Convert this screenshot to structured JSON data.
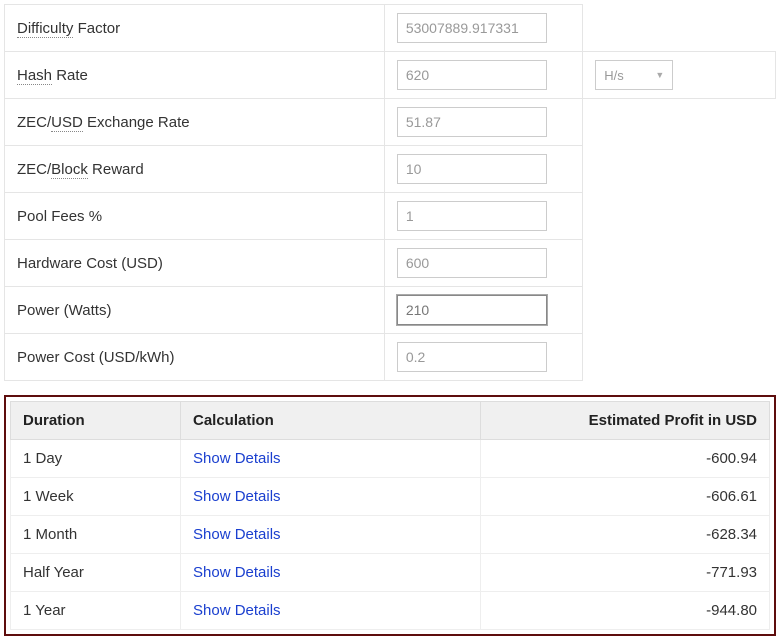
{
  "form": {
    "rows": [
      {
        "label_pre": "",
        "label_dotted": "Difficulty",
        "label_post": " Factor",
        "value": "53007889.917331",
        "has_select": false,
        "focused": false
      },
      {
        "label_pre": "",
        "label_dotted": "Hash",
        "label_post": " Rate",
        "value": "620",
        "has_select": true,
        "select_label": "H/s",
        "focused": false
      },
      {
        "label_pre": "ZEC/",
        "label_dotted": "USD",
        "label_post": " Exchange Rate",
        "value": "51.87",
        "has_select": false,
        "focused": false
      },
      {
        "label_pre": "ZEC/",
        "label_dotted": "Block",
        "label_post": " Reward",
        "value": "10",
        "has_select": false,
        "focused": false
      },
      {
        "label_pre": "Pool Fees %",
        "label_dotted": "",
        "label_post": "",
        "value": "1",
        "has_select": false,
        "focused": false
      },
      {
        "label_pre": "Hardware Cost (USD)",
        "label_dotted": "",
        "label_post": "",
        "value": "600",
        "has_select": false,
        "focused": false
      },
      {
        "label_pre": "Power (Watts)",
        "label_dotted": "",
        "label_post": "",
        "value": "210",
        "has_select": false,
        "focused": true
      },
      {
        "label_pre": "Power Cost (USD/kWh)",
        "label_dotted": "",
        "label_post": "",
        "value": "0.2",
        "has_select": false,
        "focused": false
      }
    ]
  },
  "results": {
    "headers": {
      "duration": "Duration",
      "calculation": "Calculation",
      "profit": "Estimated Profit in USD"
    },
    "link_text": "Show Details",
    "rows": [
      {
        "duration": "1 Day",
        "profit": "-600.94"
      },
      {
        "duration": "1 Week",
        "profit": "-606.61"
      },
      {
        "duration": "1 Month",
        "profit": "-628.34"
      },
      {
        "duration": "Half Year",
        "profit": "-771.93"
      },
      {
        "duration": "1 Year",
        "profit": "-944.80"
      }
    ]
  }
}
